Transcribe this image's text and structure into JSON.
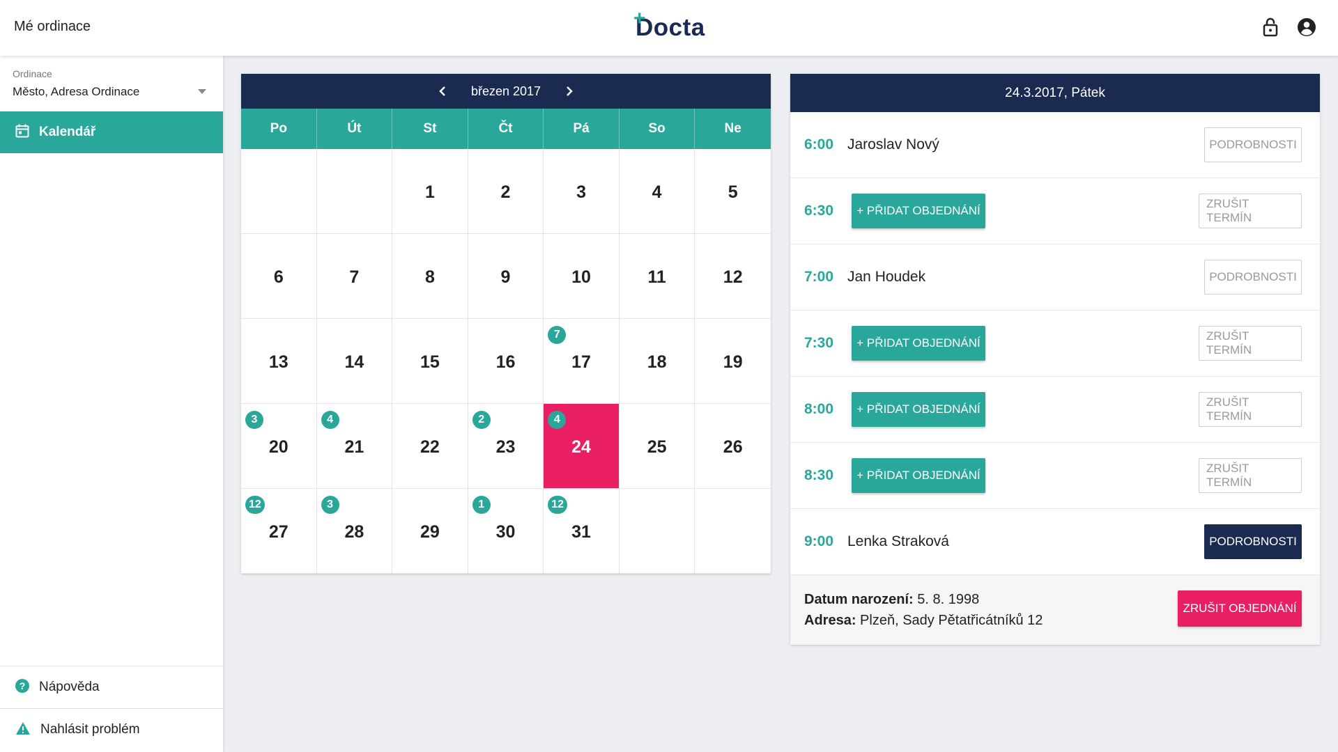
{
  "topbar": {
    "section_title": "Mé ordinace",
    "logo_text": "Docta",
    "logo_plus": "+",
    "icons": [
      "lock-icon",
      "account-icon"
    ]
  },
  "sidebar": {
    "ordinace_label": "Ordinace",
    "ordinace_value": "Město, Adresa Ordinace",
    "active_item": "Kalendář",
    "help": "Nápověda",
    "report": "Nahlásit problém"
  },
  "calendar": {
    "month_title": "březen 2017",
    "weekdays": [
      "Po",
      "Út",
      "St",
      "Čt",
      "Pá",
      "So",
      "Ne"
    ],
    "weeks": [
      [
        {
          "day": ""
        },
        {
          "day": ""
        },
        {
          "day": "1"
        },
        {
          "day": "2"
        },
        {
          "day": "3"
        },
        {
          "day": "4"
        },
        {
          "day": "5"
        }
      ],
      [
        {
          "day": "6"
        },
        {
          "day": "7"
        },
        {
          "day": "8"
        },
        {
          "day": "9"
        },
        {
          "day": "10"
        },
        {
          "day": "11"
        },
        {
          "day": "12"
        }
      ],
      [
        {
          "day": "13"
        },
        {
          "day": "14"
        },
        {
          "day": "15"
        },
        {
          "day": "16"
        },
        {
          "day": "17",
          "count": "7"
        },
        {
          "day": "18"
        },
        {
          "day": "19"
        }
      ],
      [
        {
          "day": "20",
          "count": "3"
        },
        {
          "day": "21",
          "count": "4"
        },
        {
          "day": "22"
        },
        {
          "day": "23",
          "count": "2"
        },
        {
          "day": "24",
          "count": "4",
          "selected": true
        },
        {
          "day": "25"
        },
        {
          "day": "26"
        }
      ],
      [
        {
          "day": "27",
          "count": "12"
        },
        {
          "day": "28",
          "count": "3"
        },
        {
          "day": "29"
        },
        {
          "day": "30",
          "count": "1"
        },
        {
          "day": "31",
          "count": "12"
        },
        {
          "day": ""
        },
        {
          "day": ""
        }
      ]
    ]
  },
  "schedule": {
    "date_title": "24.3.2017, Pátek",
    "slots": [
      {
        "time": "6:00",
        "patient": "Jaroslav Nový",
        "action": "PODROBNOSTI",
        "kind": "booked"
      },
      {
        "time": "6:30",
        "add_label": "+ PŘIDAT OBJEDNÁNÍ",
        "action": "ZRUŠIT TERMÍN",
        "kind": "free"
      },
      {
        "time": "7:00",
        "patient": "Jan Houdek",
        "action": "PODROBNOSTI",
        "kind": "booked"
      },
      {
        "time": "7:30",
        "add_label": "+ PŘIDAT OBJEDNÁNÍ",
        "action": "ZRUŠIT TERMÍN",
        "kind": "free"
      },
      {
        "time": "8:00",
        "add_label": "+ PŘIDAT OBJEDNÁNÍ",
        "action": "ZRUŠIT TERMÍN",
        "kind": "free"
      },
      {
        "time": "8:30",
        "add_label": "+ PŘIDAT OBJEDNÁNÍ",
        "action": "ZRUŠIT TERMÍN",
        "kind": "free"
      },
      {
        "time": "9:00",
        "patient": "Lenka Straková",
        "action": "PODROBNOSTI",
        "kind": "booked-active"
      }
    ],
    "details": {
      "birth_label": "Datum narození:",
      "birth_value": "5. 8. 1998",
      "address_label": "Adresa:",
      "address_value": "Plzeň, Sady Pětatřicátníků 12",
      "cancel_label": "ZRUŠIT OBJEDNÁNÍ"
    }
  },
  "colors": {
    "navy": "#1b2a50",
    "teal": "#2aa79b",
    "pink": "#e91e63"
  }
}
